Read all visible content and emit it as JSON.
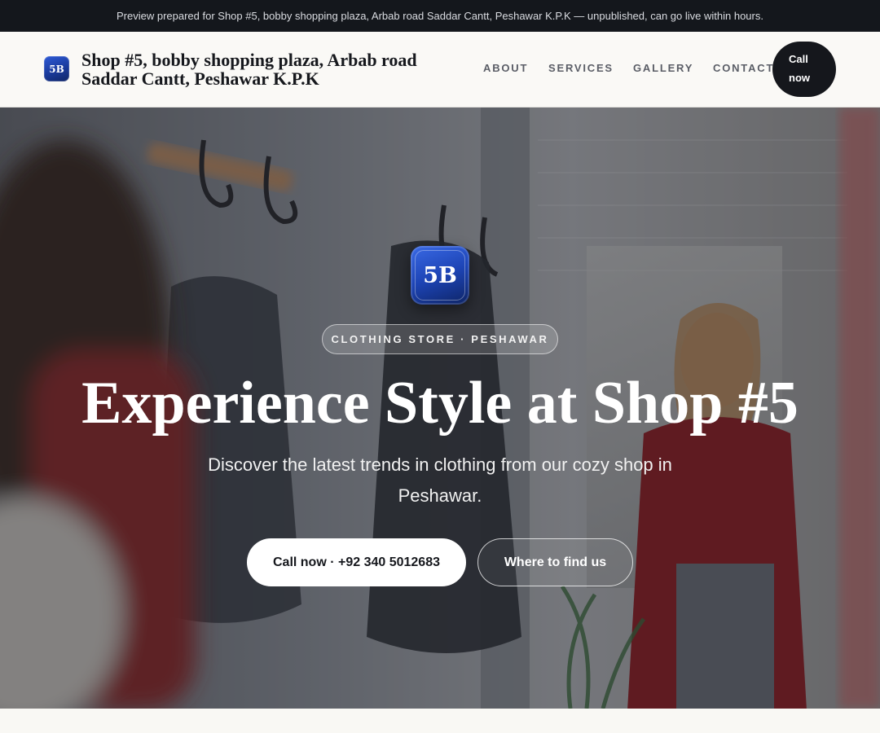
{
  "preview_bar": {
    "text": "Preview prepared for Shop #5, bobby shopping plaza, Arbab road Saddar Cantt, Peshawar K.P.K — unpublished, can go live within hours."
  },
  "header": {
    "logo_text": "5B",
    "brand_name": "Shop #5, bobby shopping plaza, Arbab road Saddar Cantt, Peshawar K.P.K",
    "nav": [
      {
        "label": "ABOUT"
      },
      {
        "label": "SERVICES"
      },
      {
        "label": "GALLERY"
      },
      {
        "label": "CONTACT"
      }
    ],
    "call_button": {
      "line1": "Call",
      "line2": "now"
    }
  },
  "hero": {
    "logo_text": "5B",
    "category_pill": "CLOTHING STORE · PESHAWAR",
    "title": "Experience Style at Shop #5",
    "subtitle": "Discover the latest trends in clothing from our cozy shop in Peshawar.",
    "primary_button": "Call now · +92 340 5012683",
    "secondary_button": "Where to find us"
  },
  "colors": {
    "topbar_bg": "#14171c",
    "header_bg": "#faf9f6",
    "ink": "#16181d",
    "brand_blue": "#1d44b5",
    "nav_text": "#5a5d66"
  }
}
